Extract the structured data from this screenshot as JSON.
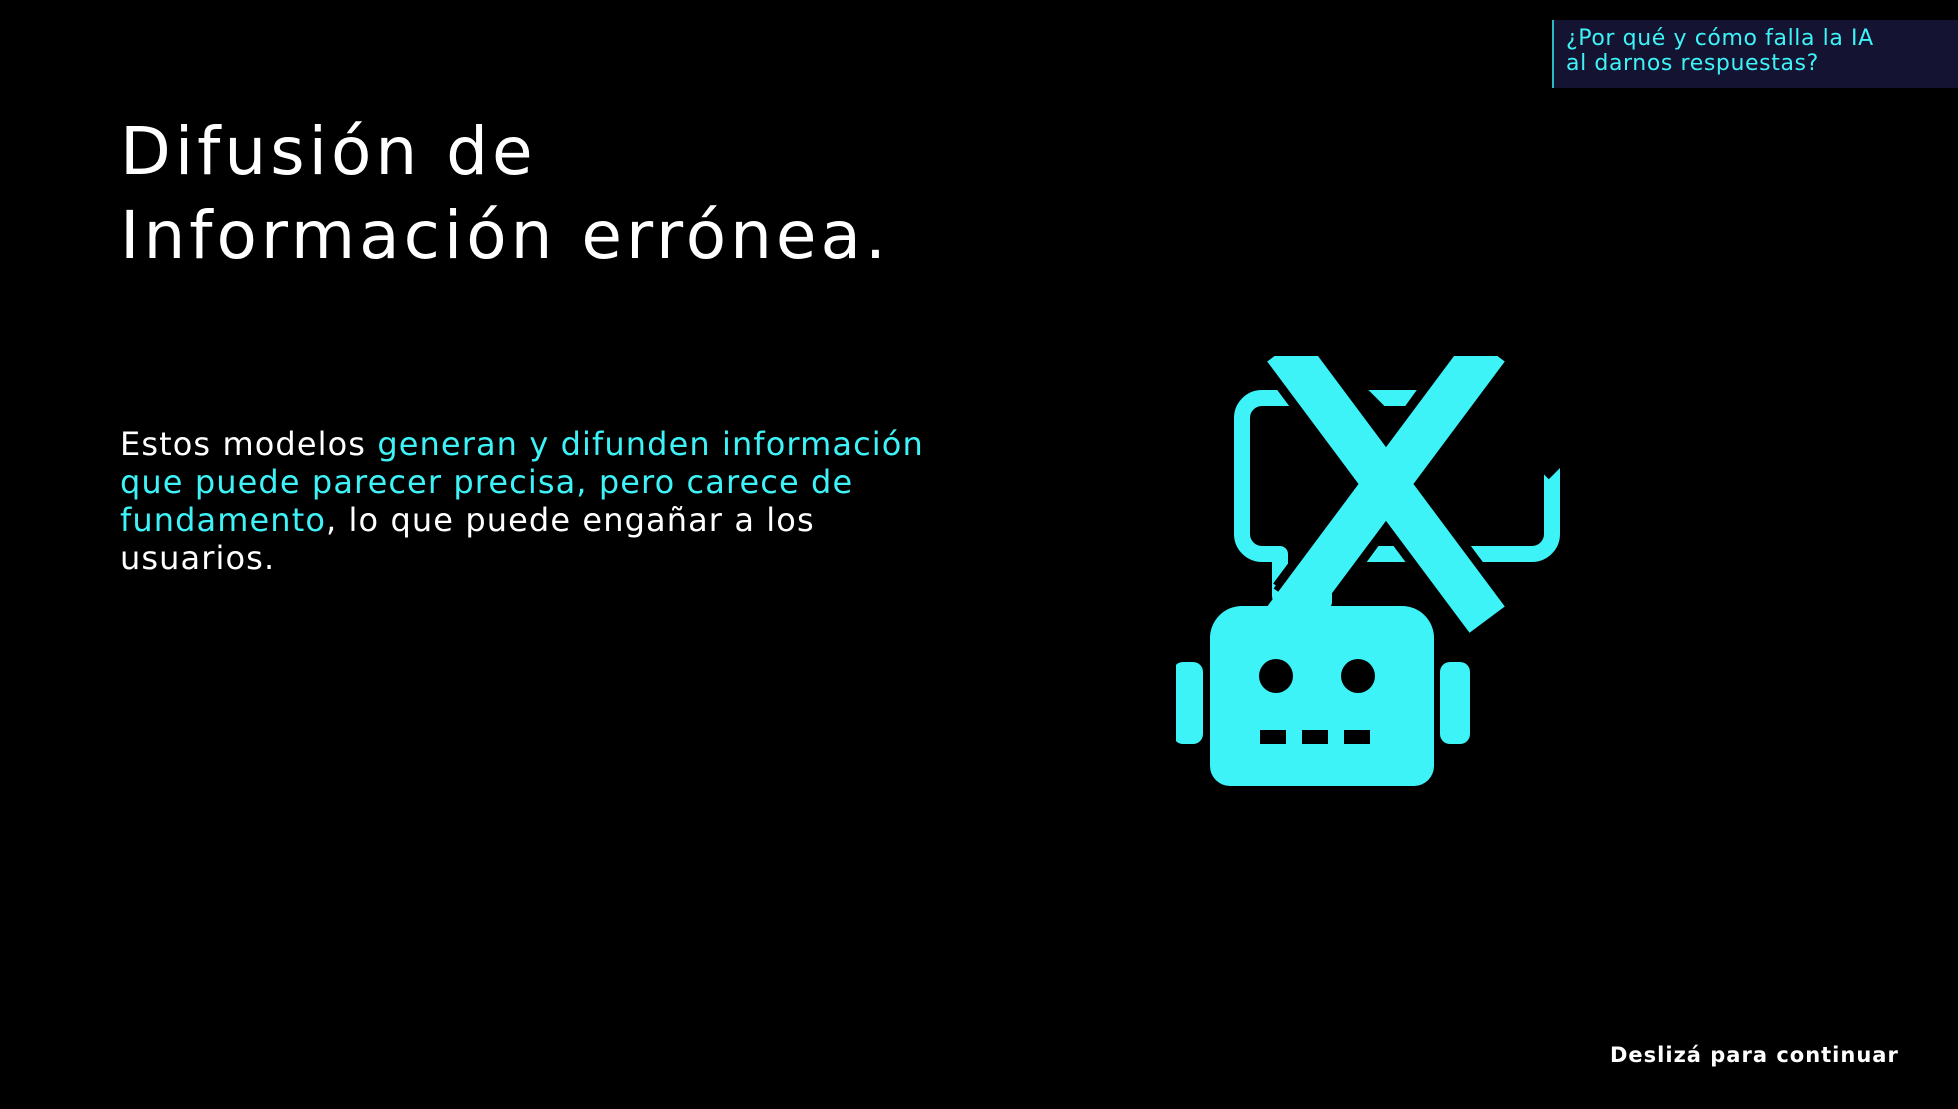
{
  "topic_tag": {
    "line1": "¿Por qué y cómo falla la IA",
    "line2": "al darnos respuestas?"
  },
  "title": {
    "line1": "Difusión de",
    "line2": "Información errónea."
  },
  "body": {
    "part1": "Estos modelos ",
    "highlight": "generan y difunden información que puede parecer precisa, pero carece de fundamento",
    "part2": ", lo que puede engañar a los usuarios."
  },
  "illustration": {
    "robot_icon": "robot-icon",
    "bubble_icon": "speech-bubble-icon",
    "cross_icon": "x-mark-icon",
    "color": "#3ef3f7"
  },
  "footer": {
    "swipe_hint": "Deslizá  para continuar"
  },
  "colors": {
    "background": "#000000",
    "accent": "#3ef3f7",
    "text": "#ffffff",
    "tag_background": "#141432"
  }
}
